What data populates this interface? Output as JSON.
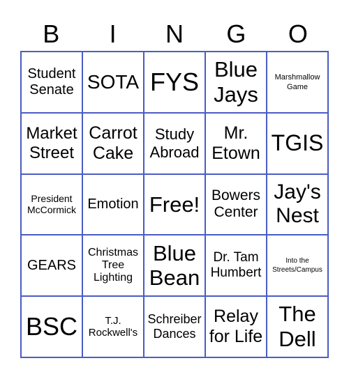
{
  "header": [
    "B",
    "I",
    "N",
    "G",
    "O"
  ],
  "border_color": "#4a5cc4",
  "cells": [
    [
      "Student Senate",
      "SOTA",
      "FYS",
      "Blue Jays",
      "Marshmallow Game"
    ],
    [
      "Market Street",
      "Carrot Cake",
      "Study Abroad",
      "Mr. Etown",
      "TGIS"
    ],
    [
      "President McCormick",
      "Emotion",
      "Free!",
      "Bowers Center",
      "Jay's Nest"
    ],
    [
      "GEARS",
      "Christmas Tree Lighting",
      "Blue Bean",
      "Dr. Tam Humbert",
      "Into the Streets/Campus"
    ],
    [
      "BSC",
      "T.J. Rockwell's",
      "Schreiber Dances",
      "Relay for Life",
      "The Dell"
    ]
  ]
}
